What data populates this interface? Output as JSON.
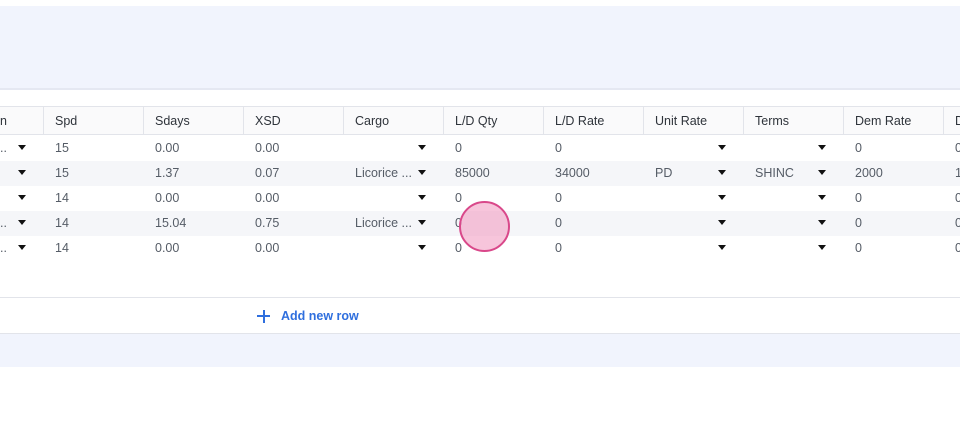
{
  "header": {
    "columns": [
      "n",
      "Spd",
      "Sdays",
      "XSD",
      "Cargo",
      "L/D Qty",
      "L/D Rate",
      "Unit Rate",
      "Terms",
      "Dem Rate",
      "D"
    ]
  },
  "rows": [
    {
      "port": "..",
      "spd": "15",
      "sdays": "0.00",
      "xsd": "0.00",
      "cargo": "",
      "ld_qty": "0",
      "ld_rate": "0",
      "unit_rate": "",
      "terms": "",
      "dem_rate": "0",
      "next": "0"
    },
    {
      "port": "",
      "spd": "15",
      "sdays": "1.37",
      "xsd": "0.07",
      "cargo": "Licorice ...",
      "ld_qty": "85000",
      "ld_rate": "34000",
      "unit_rate": "PD",
      "terms": "SHINC",
      "dem_rate": "2000",
      "next": "1"
    },
    {
      "port": "",
      "spd": "14",
      "sdays": "0.00",
      "xsd": "0.00",
      "cargo": "",
      "ld_qty": "0",
      "ld_rate": "0",
      "unit_rate": "",
      "terms": "",
      "dem_rate": "0",
      "next": "0"
    },
    {
      "port": "..",
      "spd": "14",
      "sdays": "15.04",
      "xsd": "0.75",
      "cargo": "Licorice ...",
      "ld_qty": "0",
      "ld_rate": "0",
      "unit_rate": "",
      "terms": "",
      "dem_rate": "0",
      "next": "0"
    },
    {
      "port": "..",
      "spd": "14",
      "sdays": "0.00",
      "xsd": "0.00",
      "cargo": "",
      "ld_qty": "0",
      "ld_rate": "0",
      "unit_rate": "",
      "terms": "",
      "dem_rate": "0",
      "next": "0"
    }
  ],
  "actions": {
    "add_row_label": "Add new row"
  },
  "icons": {
    "add": "plus-icon",
    "dropdown": "caret-down-icon"
  },
  "colors": {
    "accent": "#2f6fde",
    "band": "#f1f4fd",
    "alt_row": "#f5f6f9",
    "touch_indicator": "#d9488a"
  }
}
